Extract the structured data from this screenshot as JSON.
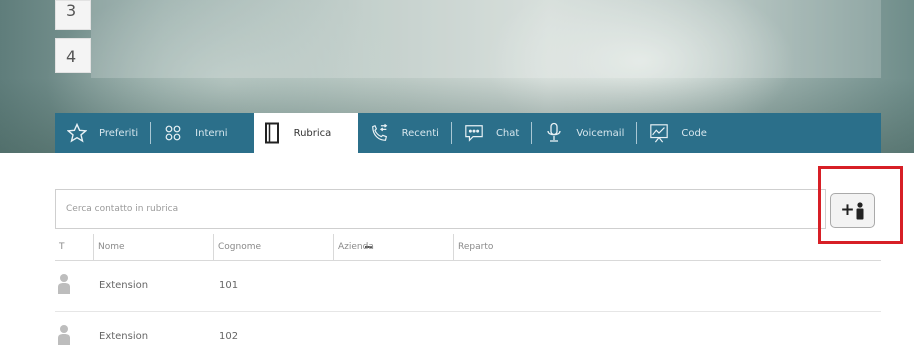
{
  "hero": {
    "numbers": [
      "3",
      "4"
    ]
  },
  "tabs": [
    {
      "label": "Preferiti",
      "icon": "star-icon"
    },
    {
      "label": "Interni",
      "icon": "group-icon"
    },
    {
      "label": "Rubrica",
      "icon": "address-book-icon",
      "active": true
    },
    {
      "label": "Recenti",
      "icon": "phone-calls-icon"
    },
    {
      "label": "Chat",
      "icon": "chat-icon"
    },
    {
      "label": "Voicemail",
      "icon": "microphone-icon"
    },
    {
      "label": "Code",
      "icon": "queue-chart-icon"
    }
  ],
  "search": {
    "placeholder": "Cerca contatto in rubrica",
    "value": ""
  },
  "add_button": {
    "label": "+",
    "icon": "add-contact-icon"
  },
  "table": {
    "columns": [
      "T",
      "Nome",
      "Cognome",
      "Azienda",
      "Reparto"
    ],
    "rows": [
      {
        "type_icon": "person-icon",
        "nome": "Extension",
        "cognome": "101"
      },
      {
        "type_icon": "person-icon",
        "nome": "Extension",
        "cognome": "102"
      }
    ]
  },
  "colors": {
    "tabbar": "#2b6f8a",
    "highlight": "#d71f26"
  }
}
